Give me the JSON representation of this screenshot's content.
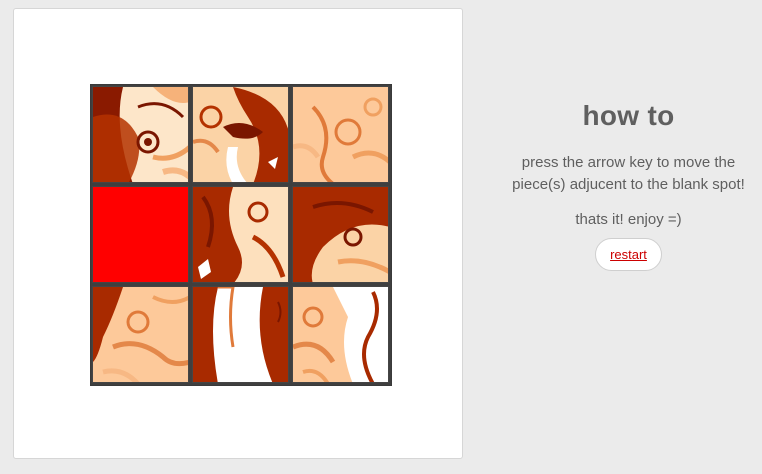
{
  "game": {
    "title": "how to",
    "instructions": "press the arrow key to move the piece(s) adjucent to the blank spot!",
    "closing": "thats it! enjoy =)",
    "restart_label": "restart",
    "grid_size": 3,
    "blank_color": "#ff0000",
    "accent_color": "#cc0000",
    "tiles": [
      {
        "position": 1,
        "piece": "top-left"
      },
      {
        "position": 2,
        "piece": "top-center"
      },
      {
        "position": 3,
        "piece": "top-right"
      },
      {
        "position": 4,
        "piece": "blank"
      },
      {
        "position": 5,
        "piece": "middle-center"
      },
      {
        "position": 6,
        "piece": "middle-right"
      },
      {
        "position": 7,
        "piece": "bottom-left"
      },
      {
        "position": 8,
        "piece": "bottom-center"
      },
      {
        "position": 9,
        "piece": "bottom-right"
      }
    ]
  }
}
